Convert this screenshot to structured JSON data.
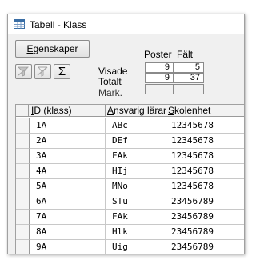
{
  "window": {
    "title": "Tabell - Klass",
    "icon": "table-icon"
  },
  "toolbar": {
    "properties_label_accel": "E",
    "properties_label_rest": "genskaper",
    "filter_icon": "filter-off-icon",
    "filter2_icon": "filter-selection-off-icon",
    "sum_label": "Σ"
  },
  "stats": {
    "header_posts": "Poster",
    "header_fields": "Fält",
    "row_shown_label": "Visade",
    "row_total_label": "Totalt",
    "row_marked_label": "Mark.",
    "shown_posts": "9",
    "shown_fields": "5",
    "total_posts": "9",
    "total_fields": "37",
    "marked_posts": "",
    "marked_fields": ""
  },
  "grid": {
    "columns": [
      {
        "label": "ID (klass)",
        "accel": "I",
        "rest": "D (klass)"
      },
      {
        "label": "Ansvarig lärare",
        "accel": "A",
        "rest": "nsvarig lärare"
      },
      {
        "label": "Skolenhet",
        "accel": "S",
        "rest": "kolenhet"
      }
    ],
    "rows": [
      [
        "1A",
        "ABc",
        "12345678"
      ],
      [
        "2A",
        "DEf",
        "12345678"
      ],
      [
        "3A",
        "FAk",
        "12345678"
      ],
      [
        "4A",
        "HIj",
        "12345678"
      ],
      [
        "5A",
        "MNo",
        "12345678"
      ],
      [
        "6A",
        "STu",
        "23456789"
      ],
      [
        "7A",
        "FAk",
        "23456789"
      ],
      [
        "8A",
        "Hlk",
        "23456789"
      ],
      [
        "9A",
        "Uig",
        "23456789"
      ]
    ]
  }
}
